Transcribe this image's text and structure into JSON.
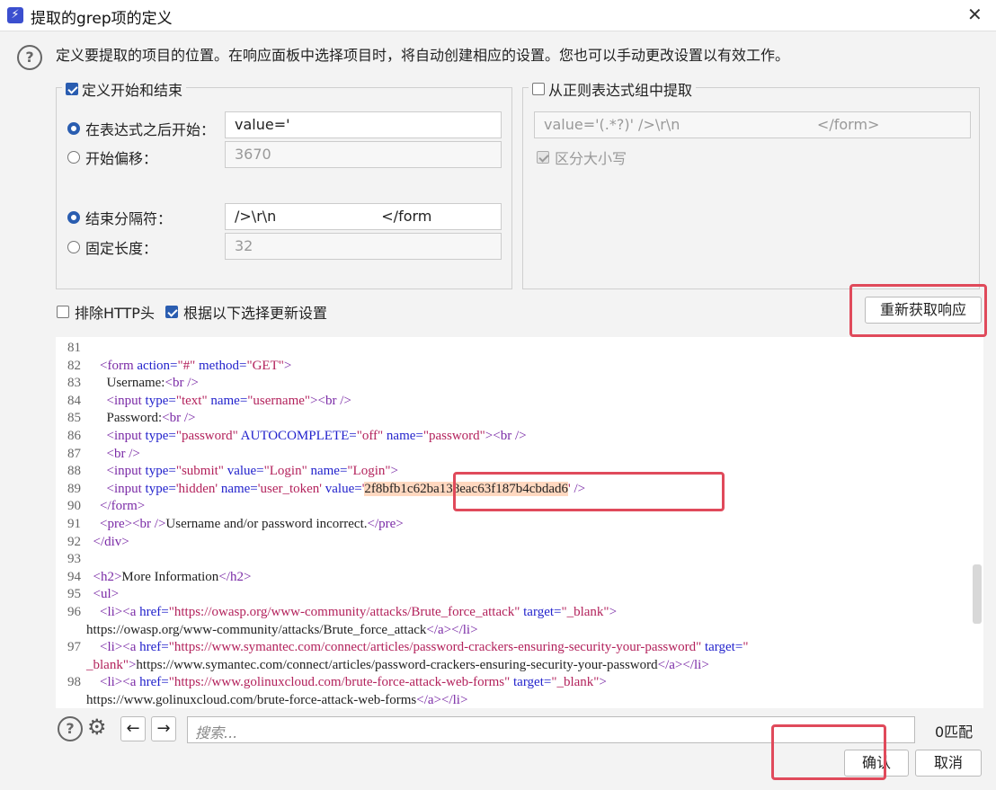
{
  "window": {
    "title": "提取的grep项的定义"
  },
  "description": "定义要提取的项目的位置。在响应面板中选择项目时，将自动创建相应的设置。您也可以手动更改设置以有效工作。",
  "left_group": {
    "title": "定义开始和结束",
    "start_after_label": "在表达式之后开始：",
    "start_after_value": "value='",
    "start_offset_label": "开始偏移：",
    "start_offset_value": "3670",
    "end_delim_label": "结束分隔符：",
    "end_delim_value": "/>\\r\\n                       </form",
    "fixed_len_label": "固定长度：",
    "fixed_len_value": "32"
  },
  "right_group": {
    "title": "从正则表达式组中提取",
    "regex_value": "value='(.*?)' />\\r\\n                              </form>",
    "case_label": "区分大小写"
  },
  "options": {
    "exclude_http": "排除HTTP头",
    "update_label": "根据以下选择更新设置",
    "refetch_button": "重新获取响应"
  },
  "code_lines": [
    {
      "n": "81",
      "indent": "",
      "parts": []
    },
    {
      "n": "82",
      "indent": "    ",
      "parts": [
        [
          "tg",
          "<form "
        ],
        [
          "at",
          "action="
        ],
        [
          "vl",
          "\"#\""
        ],
        [
          "at",
          " method="
        ],
        [
          "vl",
          "\"GET\""
        ],
        [
          "tg",
          ">"
        ]
      ]
    },
    {
      "n": "83",
      "indent": "      ",
      "parts": [
        [
          "tx",
          "Username:"
        ],
        [
          "tg",
          "<br />"
        ]
      ]
    },
    {
      "n": "84",
      "indent": "      ",
      "parts": [
        [
          "tg",
          "<input "
        ],
        [
          "at",
          "type="
        ],
        [
          "vl",
          "\"text\""
        ],
        [
          "at",
          " name="
        ],
        [
          "vl",
          "\"username\""
        ],
        [
          "tg",
          ">"
        ],
        [
          "tg",
          "<br />"
        ]
      ]
    },
    {
      "n": "85",
      "indent": "      ",
      "parts": [
        [
          "tx",
          "Password:"
        ],
        [
          "tg",
          "<br />"
        ]
      ]
    },
    {
      "n": "86",
      "indent": "      ",
      "parts": [
        [
          "tg",
          "<input "
        ],
        [
          "at",
          "type="
        ],
        [
          "vl",
          "\"password\""
        ],
        [
          "at",
          " AUTOCOMPLETE="
        ],
        [
          "vl",
          "\"off\""
        ],
        [
          "at",
          " name="
        ],
        [
          "vl",
          "\"password\""
        ],
        [
          "tg",
          ">"
        ],
        [
          "tg",
          "<br />"
        ]
      ]
    },
    {
      "n": "87",
      "indent": "      ",
      "parts": [
        [
          "tg",
          "<br />"
        ]
      ]
    },
    {
      "n": "88",
      "indent": "      ",
      "parts": [
        [
          "tg",
          "<input "
        ],
        [
          "at",
          "type="
        ],
        [
          "vl",
          "\"submit\""
        ],
        [
          "at",
          " value="
        ],
        [
          "vl",
          "\"Login\""
        ],
        [
          "at",
          " name="
        ],
        [
          "vl",
          "\"Login\""
        ],
        [
          "tg",
          ">"
        ]
      ]
    },
    {
      "n": "89",
      "indent": "      ",
      "parts": [
        [
          "tg",
          "<input "
        ],
        [
          "at",
          "type="
        ],
        [
          "vl",
          "'hidden'"
        ],
        [
          "at",
          " name="
        ],
        [
          "vl",
          "'user_token'"
        ],
        [
          "at",
          " value="
        ],
        [
          "vl",
          "'"
        ],
        [
          "hl",
          "2f8bfb1c62ba138eac63f187b4cbdad6"
        ],
        [
          "vl",
          "'"
        ],
        [
          "tg",
          " />"
        ]
      ]
    },
    {
      "n": "90",
      "indent": "    ",
      "parts": [
        [
          "tg",
          "</form>"
        ]
      ]
    },
    {
      "n": "91",
      "indent": "    ",
      "parts": [
        [
          "tg",
          "<pre>"
        ],
        [
          "tg",
          "<br />"
        ],
        [
          "tx",
          "Username and/or password incorrect."
        ],
        [
          "tg",
          "</pre>"
        ]
      ]
    },
    {
      "n": "92",
      "indent": "  ",
      "parts": [
        [
          "tg",
          "</div>"
        ]
      ]
    },
    {
      "n": "93",
      "indent": "",
      "parts": []
    },
    {
      "n": "94",
      "indent": "  ",
      "parts": [
        [
          "tg",
          "<h2>"
        ],
        [
          "tx",
          "More Information"
        ],
        [
          "tg",
          "</h2>"
        ]
      ]
    },
    {
      "n": "95",
      "indent": "  ",
      "parts": [
        [
          "tg",
          "<ul>"
        ]
      ]
    },
    {
      "n": "96",
      "indent": "    ",
      "parts": [
        [
          "tg",
          "<li>"
        ],
        [
          "tg",
          "<a "
        ],
        [
          "at",
          "href="
        ],
        [
          "vl",
          "\"https://owasp.org/www-community/attacks/Brute_force_attack\""
        ],
        [
          "at",
          " target="
        ],
        [
          "vl",
          "\"_blank\""
        ],
        [
          "tg",
          ">"
        ]
      ]
    },
    {
      "n": "",
      "indent": "",
      "parts": [
        [
          "tx",
          "https://owasp.org/www-community/attacks/Brute_force_attack"
        ],
        [
          "tg",
          "</a>"
        ],
        [
          "tg",
          "</li>"
        ]
      ]
    },
    {
      "n": "97",
      "indent": "    ",
      "parts": [
        [
          "tg",
          "<li>"
        ],
        [
          "tg",
          "<a "
        ],
        [
          "at",
          "href="
        ],
        [
          "vl",
          "\"https://www.symantec.com/connect/articles/password-crackers-ensuring-security-your-password\""
        ],
        [
          "at",
          " target="
        ],
        [
          "vl",
          "\""
        ]
      ]
    },
    {
      "n": "",
      "indent": "",
      "parts": [
        [
          "vl",
          "_blank\""
        ],
        [
          "tg",
          ">"
        ],
        [
          "tx",
          "https://www.symantec.com/connect/articles/password-crackers-ensuring-security-your-password"
        ],
        [
          "tg",
          "</a>"
        ],
        [
          "tg",
          "</li>"
        ]
      ]
    },
    {
      "n": "98",
      "indent": "    ",
      "parts": [
        [
          "tg",
          "<li>"
        ],
        [
          "tg",
          "<a "
        ],
        [
          "at",
          "href="
        ],
        [
          "vl",
          "\"https://www.golinuxcloud.com/brute-force-attack-web-forms\""
        ],
        [
          "at",
          " target="
        ],
        [
          "vl",
          "\"_blank\""
        ],
        [
          "tg",
          ">"
        ]
      ]
    },
    {
      "n": "",
      "indent": "",
      "parts": [
        [
          "tx",
          "https://www.golinuxcloud.com/brute-force-attack-web-forms"
        ],
        [
          "tg",
          "</a>"
        ],
        [
          "tg",
          "</li>"
        ]
      ]
    }
  ],
  "search": {
    "placeholder": "搜索...",
    "match_count": "0匹配"
  },
  "footer": {
    "ok": "确认",
    "cancel": "取消"
  },
  "icons": {
    "help": "help-icon",
    "gear": "gear-icon",
    "prev": "arrow-left-icon",
    "next": "arrow-right-icon",
    "app": "app-icon",
    "close": "close-icon"
  },
  "colors": {
    "accent": "#2a5db0",
    "highlight_box": "#e04a5b",
    "token_highlight": "#ffd8c0"
  }
}
